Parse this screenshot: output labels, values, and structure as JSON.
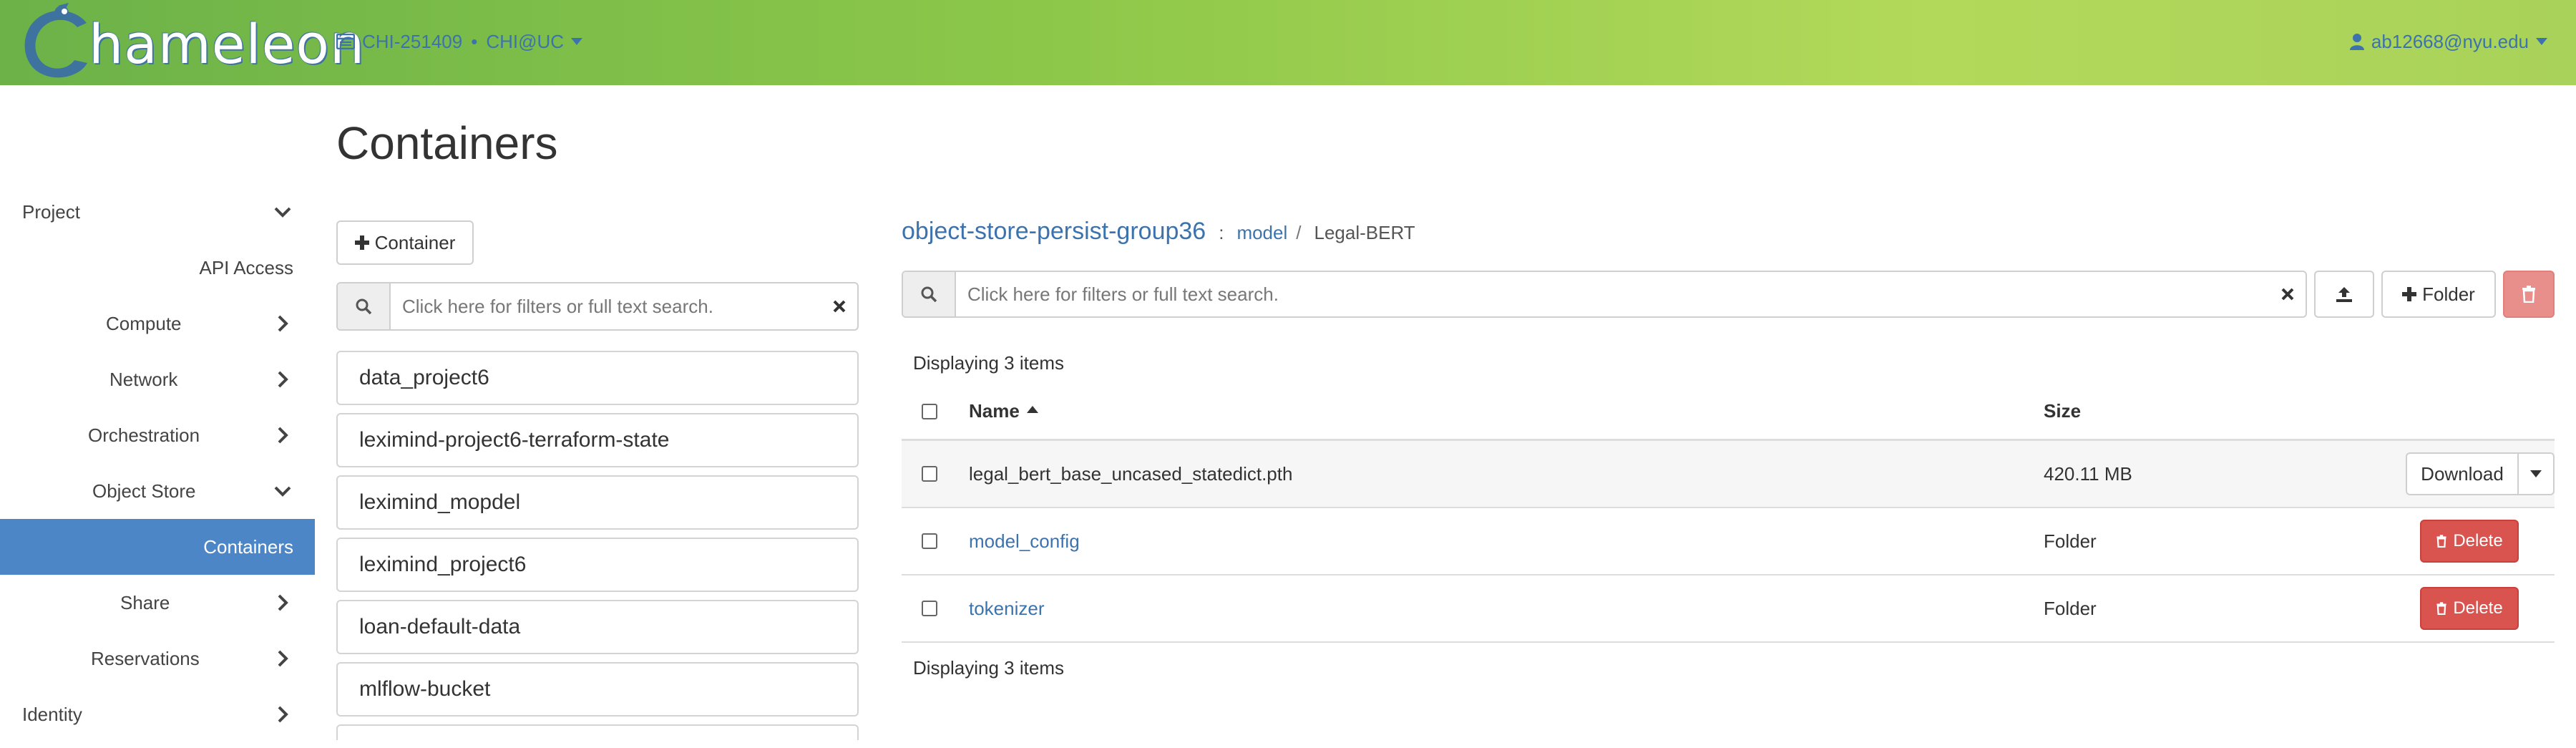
{
  "banner": {
    "logo_text": "hameleon",
    "project_label": "CHI-251409",
    "project_separator": "•",
    "site_label": "CHI@UC",
    "user_label": "ab12668@nyu.edu"
  },
  "sidebar": {
    "items": [
      {
        "label": "Project",
        "icon": "chevron-down-icon"
      },
      {
        "label": "API Access",
        "icon": ""
      },
      {
        "label": "Compute",
        "icon": "chevron-right-icon"
      },
      {
        "label": "Network",
        "icon": "chevron-right-icon"
      },
      {
        "label": "Orchestration",
        "icon": "chevron-right-icon"
      },
      {
        "label": "Object Store",
        "icon": "chevron-down-icon"
      },
      {
        "label": "Containers",
        "icon": "",
        "active": true
      },
      {
        "label": "Share",
        "icon": "chevron-right-icon"
      },
      {
        "label": "Reservations",
        "icon": "chevron-right-icon"
      },
      {
        "label": "Identity",
        "icon": "chevron-right-icon"
      }
    ]
  },
  "page": {
    "title": "Containers"
  },
  "containers_panel": {
    "add_button": "Container",
    "search_placeholder": "Click here for filters or full text search.",
    "items": [
      "data_project6",
      "leximind-project6-terraform-state",
      "leximind_mopdel",
      "leximind_project6",
      "loan-default-data",
      "mlflow-bucket"
    ]
  },
  "objects_panel": {
    "breadcrumb": {
      "container": "object-store-persist-group36",
      "colon": ":",
      "folder": "model",
      "slash": "/",
      "current": "Legal-BERT"
    },
    "search_placeholder": "Click here for filters or full text search.",
    "folder_button": "Folder",
    "display_count_top": "Displaying 3 items",
    "display_count_bottom": "Displaying 3 items",
    "columns": {
      "name": "Name",
      "size": "Size"
    },
    "rows": [
      {
        "name": "legal_bert_base_uncased_statedict.pth",
        "size": "420.11 MB",
        "kind": "file",
        "action": "Download"
      },
      {
        "name": "model_config",
        "size": "Folder",
        "kind": "folder",
        "action": "Delete"
      },
      {
        "name": "tokenizer",
        "size": "Folder",
        "kind": "folder",
        "action": "Delete"
      }
    ]
  },
  "colors": {
    "accent": "#4d86c6",
    "link": "#3c73ad",
    "danger": "#d9534f",
    "banner_green": "#8cc749"
  }
}
